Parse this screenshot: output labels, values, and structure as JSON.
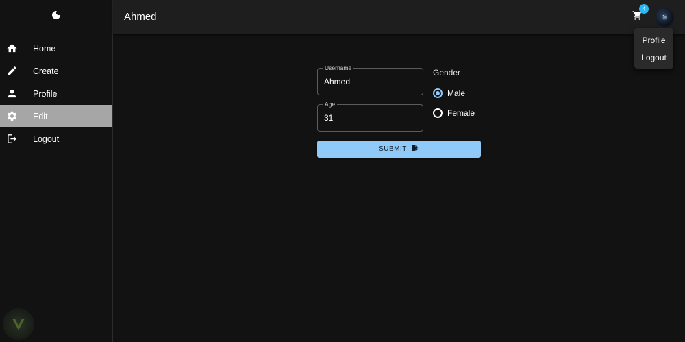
{
  "header": {
    "title": "Ahmed",
    "cart_count": "4",
    "cart_icon": "shopping-cart-icon",
    "avatar_icon": "avatar"
  },
  "sidebar": {
    "theme_icon": "moon-icon",
    "items": [
      {
        "label": "Home",
        "icon": "home-icon",
        "active": false
      },
      {
        "label": "Create",
        "icon": "pencil-icon",
        "active": false
      },
      {
        "label": "Profile",
        "icon": "person-icon",
        "active": false
      },
      {
        "label": "Edit",
        "icon": "gear-icon",
        "active": true
      },
      {
        "label": "Logout",
        "icon": "logout-icon",
        "active": false
      }
    ]
  },
  "account_menu": {
    "items": [
      "Profile",
      "Logout"
    ]
  },
  "form": {
    "username": {
      "label": "Username",
      "value": "Ahmed"
    },
    "age": {
      "label": "Age",
      "value": "31"
    },
    "gender": {
      "label": "Gender",
      "options": [
        "Male",
        "Female"
      ],
      "selected": "Male"
    },
    "submit_label": "SUBMIT"
  },
  "colors": {
    "accent": "#90caf9",
    "badge": "#29b6f6",
    "background": "#121212",
    "appbar": "#1e1e1e",
    "active_nav": "#a6a6a6"
  }
}
